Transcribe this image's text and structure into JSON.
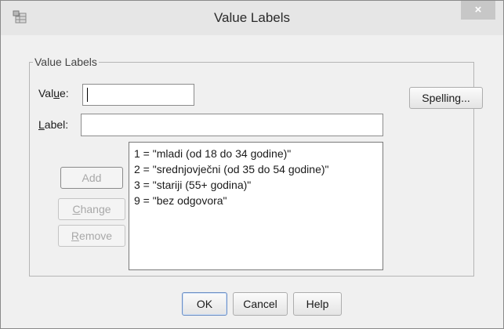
{
  "window": {
    "title": "Value Labels",
    "close_glyph": "×"
  },
  "group": {
    "legend": "Value Labels"
  },
  "value_field": {
    "label_pre": "Val",
    "label_key": "u",
    "label_post": "e:",
    "value": ""
  },
  "label_field": {
    "label_key": "L",
    "label_post": "abel:",
    "value": ""
  },
  "buttons": {
    "spelling": "Spelling...",
    "add": "Add",
    "change_key": "C",
    "change_rest": "hange",
    "remove_key": "R",
    "remove_rest": "emove",
    "ok": "OK",
    "cancel": "Cancel",
    "help": "Help"
  },
  "list": {
    "items": [
      "1 = \"mladi (od 18 do 34 godine)\"",
      "2 = \"srednjovječni (od 35 do 54 godine)\"",
      "3 = \"stariji (55+ godina)\"",
      "9 = \"bez odgovora\""
    ]
  },
  "icons": {
    "app": "spss-table-icon",
    "close": "close-icon"
  }
}
